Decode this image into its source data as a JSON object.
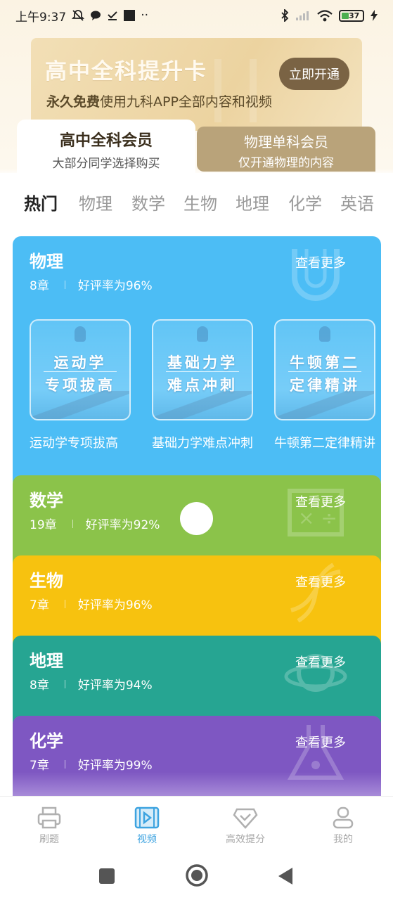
{
  "status_bar": {
    "time": "上午9:37",
    "battery": "37"
  },
  "banner": {
    "title": "高中全科提升卡",
    "subtitle_bold": "永久免费",
    "subtitle_rest": "使用九科APP全部内容和视频",
    "cta": "立即开通"
  },
  "membership": {
    "active": {
      "title": "高中全科会员",
      "desc": "大部分同学选择购买"
    },
    "inactive": {
      "title": "物理单科会员",
      "desc": "仅开通物理的内容"
    }
  },
  "subject_tabs": [
    "热门",
    "物理",
    "数学",
    "生物",
    "地理",
    "化学",
    "英语"
  ],
  "cards": [
    {
      "title": "物理",
      "chapters": "8章",
      "rating": "好评率为96%",
      "more": "查看更多",
      "color": "#4cbdf5",
      "courses": [
        {
          "line1": "运动学",
          "line2": "专项拔高",
          "label": "运动学专项拔高"
        },
        {
          "line1": "基础力学",
          "line2": "难点冲刺",
          "label": "基础力学难点冲刺"
        },
        {
          "line1": "牛顿第二",
          "line2": "定律精讲",
          "label": "牛顿第二定律精讲"
        }
      ]
    },
    {
      "title": "数学",
      "chapters": "19章",
      "rating": "好评率为92%",
      "more": "查看更多",
      "color": "#8bc34a"
    },
    {
      "title": "生物",
      "chapters": "7章",
      "rating": "好评率为96%",
      "more": "查看更多",
      "color": "#f7c20f"
    },
    {
      "title": "地理",
      "chapters": "8章",
      "rating": "好评率为94%",
      "more": "查看更多",
      "color": "#26a592"
    },
    {
      "title": "化学",
      "chapters": "7章",
      "rating": "好评率为99%",
      "more": "查看更多",
      "color": "#7e57c2"
    }
  ],
  "bottom_nav": [
    {
      "label": "刷题",
      "icon": "printer-icon"
    },
    {
      "label": "视频",
      "icon": "video-play-icon",
      "active": true
    },
    {
      "label": "高效提分",
      "icon": "diamond-check-icon"
    },
    {
      "label": "我的",
      "icon": "profile-icon"
    }
  ]
}
